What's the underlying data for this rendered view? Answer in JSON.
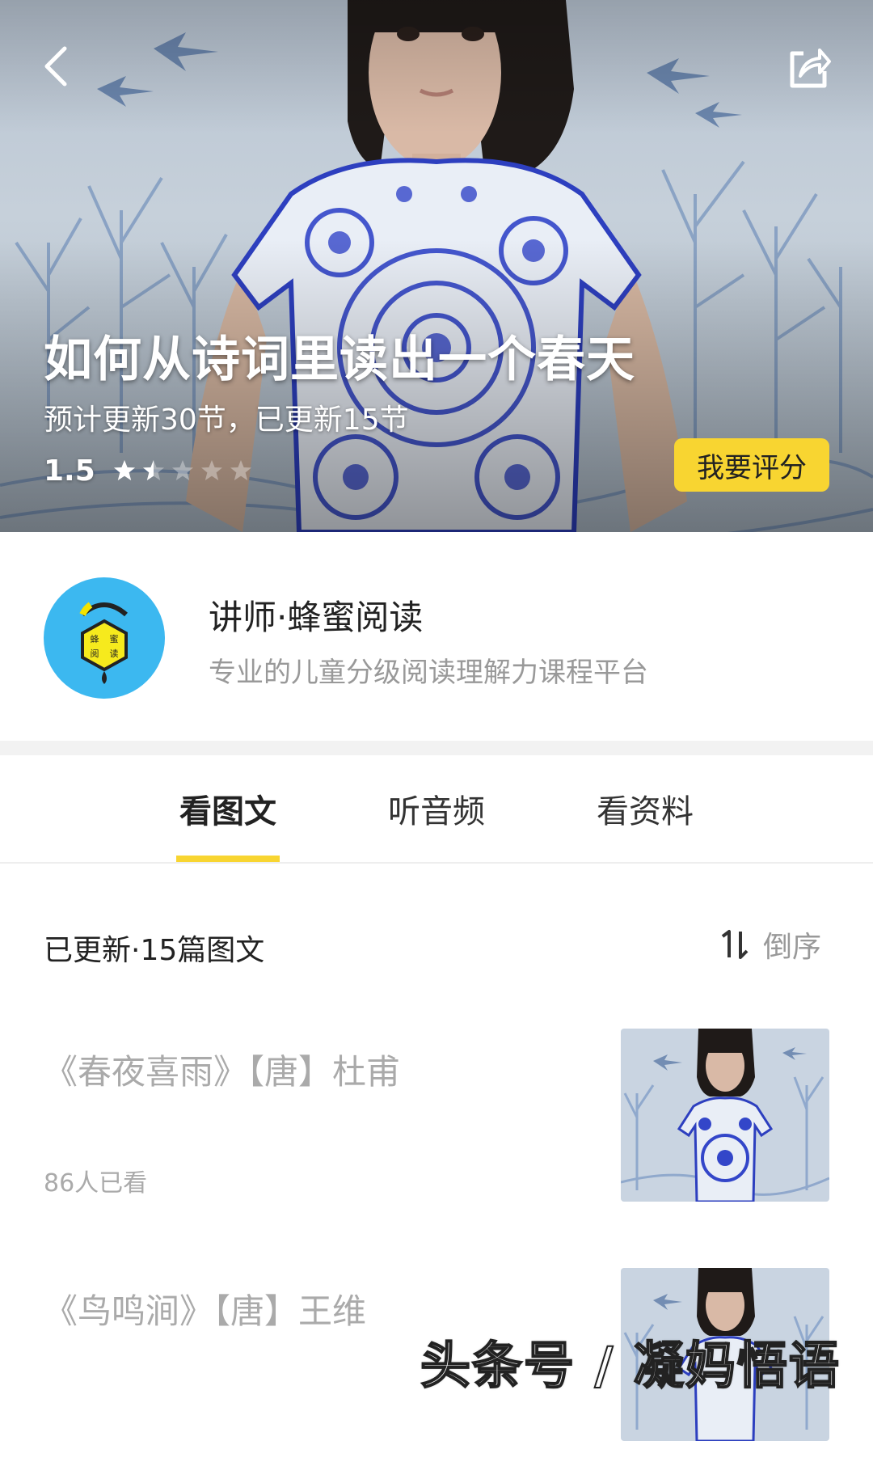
{
  "hero": {
    "title": "如何从诗词里读出一个春天",
    "progress": "预计更新30节，已更新15节",
    "rating": "1.5",
    "rating_value": 1.5,
    "rating_max": 5,
    "rate_button": "我要评分",
    "back_icon": "back-chevron-icon",
    "share_icon": "share-icon"
  },
  "lecturer": {
    "name": "讲师·蜂蜜阅读",
    "description": "专业的儿童分级阅读理解力课程平台",
    "avatar_text": [
      "蜂",
      "蜜",
      "阅",
      "读"
    ]
  },
  "tabs": [
    {
      "label": "看图文",
      "active": true
    },
    {
      "label": "听音频",
      "active": false
    },
    {
      "label": "看资料",
      "active": false
    }
  ],
  "list": {
    "header": "已更新·15篇图文",
    "sort_label": "倒序",
    "articles": [
      {
        "title": "《春夜喜雨》【唐】杜甫",
        "views": "86人已看"
      },
      {
        "title": "《鸟鸣涧》【唐】王维",
        "views": ""
      }
    ]
  },
  "watermark": "头条号 / 凝妈悟语",
  "colors": {
    "accent_yellow": "#f8d531",
    "avatar_blue": "#3cb8f0",
    "muted_text": "#aaaaaa"
  }
}
